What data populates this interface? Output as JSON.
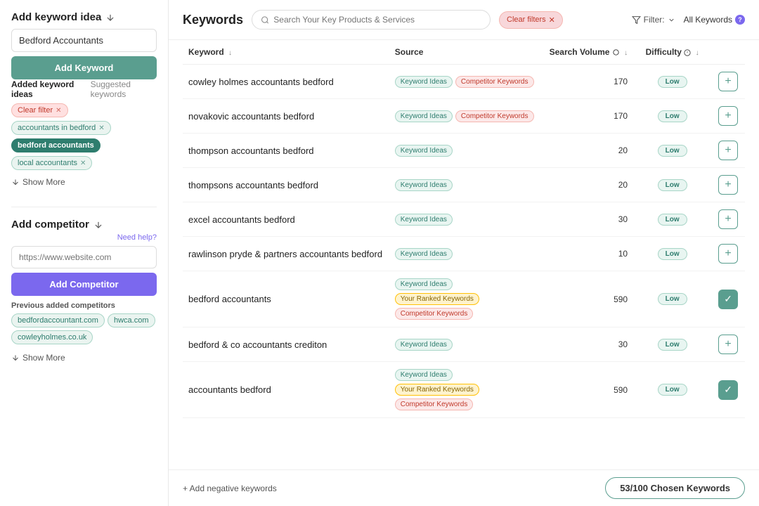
{
  "sidebar": {
    "add_keyword_section": {
      "title": "Add keyword idea",
      "input_placeholder": "Bedford Accountants",
      "input_value": "Bedford Accountants",
      "add_btn_label": "Add Keyword",
      "tab_added": "Added keyword ideas",
      "tab_suggested": "Suggested keywords",
      "clear_filter_label": "Clear filter",
      "tags": [
        {
          "id": "accountants-in-bedford",
          "label": "accountants in bedford"
        },
        {
          "id": "bedford-accountants",
          "label": "bedford accountants",
          "active": true
        },
        {
          "id": "local-accountants",
          "label": "local accountants"
        }
      ],
      "show_more_label": "Show More"
    },
    "add_competitor_section": {
      "title": "Add competitor",
      "need_help_label": "Need help?",
      "input_placeholder": "https://www.website.com",
      "add_btn_label": "Add Competitor",
      "prev_label": "Previous added competitors",
      "competitors": [
        {
          "id": "bedfordaccountant",
          "label": "bedfordaccountant.com"
        },
        {
          "id": "hwca",
          "label": "hwca.com"
        },
        {
          "id": "cowleyholmes",
          "label": "cowleyholmes.co.uk"
        }
      ],
      "show_more_label": "Show More"
    }
  },
  "main": {
    "title": "Keywords",
    "search_placeholder": "Search Your Key Products & Services",
    "clear_filters_label": "Clear filters",
    "filter_label": "Filter:",
    "all_keywords_label": "All Keywords",
    "table": {
      "columns": [
        {
          "id": "keyword",
          "label": "Keyword"
        },
        {
          "id": "source",
          "label": "Source"
        },
        {
          "id": "volume",
          "label": "Search Volume"
        },
        {
          "id": "difficulty",
          "label": "Difficulty"
        },
        {
          "id": "action",
          "label": ""
        }
      ],
      "rows": [
        {
          "keyword": "cowley holmes accountants bedford",
          "sources": [
            "Keyword Ideas",
            "Competitor Keywords"
          ],
          "volume": "170",
          "difficulty": "Low",
          "added": false
        },
        {
          "keyword": "novakovic accountants bedford",
          "sources": [
            "Keyword Ideas",
            "Competitor Keywords"
          ],
          "volume": "170",
          "difficulty": "Low",
          "added": false
        },
        {
          "keyword": "thompson accountants bedford",
          "sources": [
            "Keyword Ideas"
          ],
          "volume": "20",
          "difficulty": "Low",
          "added": false
        },
        {
          "keyword": "thompsons accountants bedford",
          "sources": [
            "Keyword Ideas"
          ],
          "volume": "20",
          "difficulty": "Low",
          "added": false
        },
        {
          "keyword": "excel accountants bedford",
          "sources": [
            "Keyword Ideas"
          ],
          "volume": "30",
          "difficulty": "Low",
          "added": false
        },
        {
          "keyword": "rawlinson pryde & partners accountants bedford",
          "sources": [
            "Keyword Ideas"
          ],
          "volume": "10",
          "difficulty": "Low",
          "added": false
        },
        {
          "keyword": "bedford accountants",
          "sources": [
            "Keyword Ideas",
            "Your Ranked Keywords",
            "Competitor Keywords"
          ],
          "volume": "590",
          "difficulty": "Low",
          "added": true
        },
        {
          "keyword": "bedford & co accountants crediton",
          "sources": [
            "Keyword Ideas"
          ],
          "volume": "30",
          "difficulty": "Low",
          "added": false
        },
        {
          "keyword": "accountants bedford",
          "sources": [
            "Keyword Ideas",
            "Your Ranked Keywords",
            "Competitor Keywords"
          ],
          "volume": "590",
          "difficulty": "Low",
          "added": true
        }
      ]
    },
    "footer": {
      "add_negative_label": "+ Add negative keywords",
      "chosen_label": "53/100 Chosen Keywords"
    }
  }
}
